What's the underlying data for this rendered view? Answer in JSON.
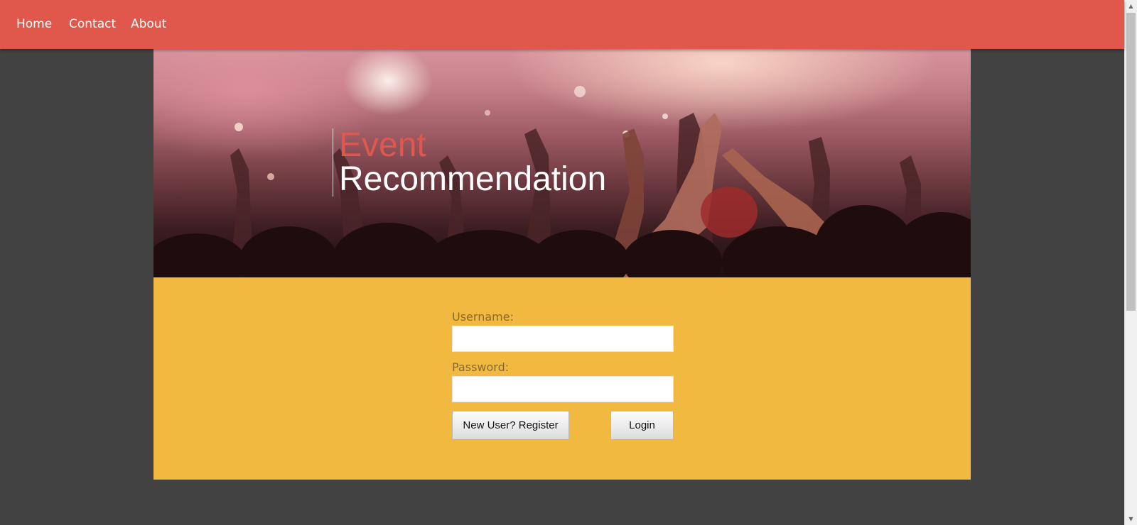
{
  "nav": {
    "items": [
      {
        "label": "Home"
      },
      {
        "label": "Contact"
      },
      {
        "label": "About"
      }
    ]
  },
  "hero": {
    "title_line1": "Event",
    "title_line2": "Recommendation"
  },
  "login": {
    "username_label": "Username:",
    "username_value": "",
    "password_label": "Password:",
    "password_value": "",
    "register_button": "New User? Register",
    "login_button": "Login"
  },
  "colors": {
    "nav_background": "#e0574b",
    "page_background": "#424242",
    "panel_background": "#f2b941",
    "title_accent": "#e0574b",
    "title_main": "#ffffff"
  },
  "icons": {
    "scroll_up": "triangle-up-icon",
    "scroll_down": "triangle-down-icon"
  }
}
